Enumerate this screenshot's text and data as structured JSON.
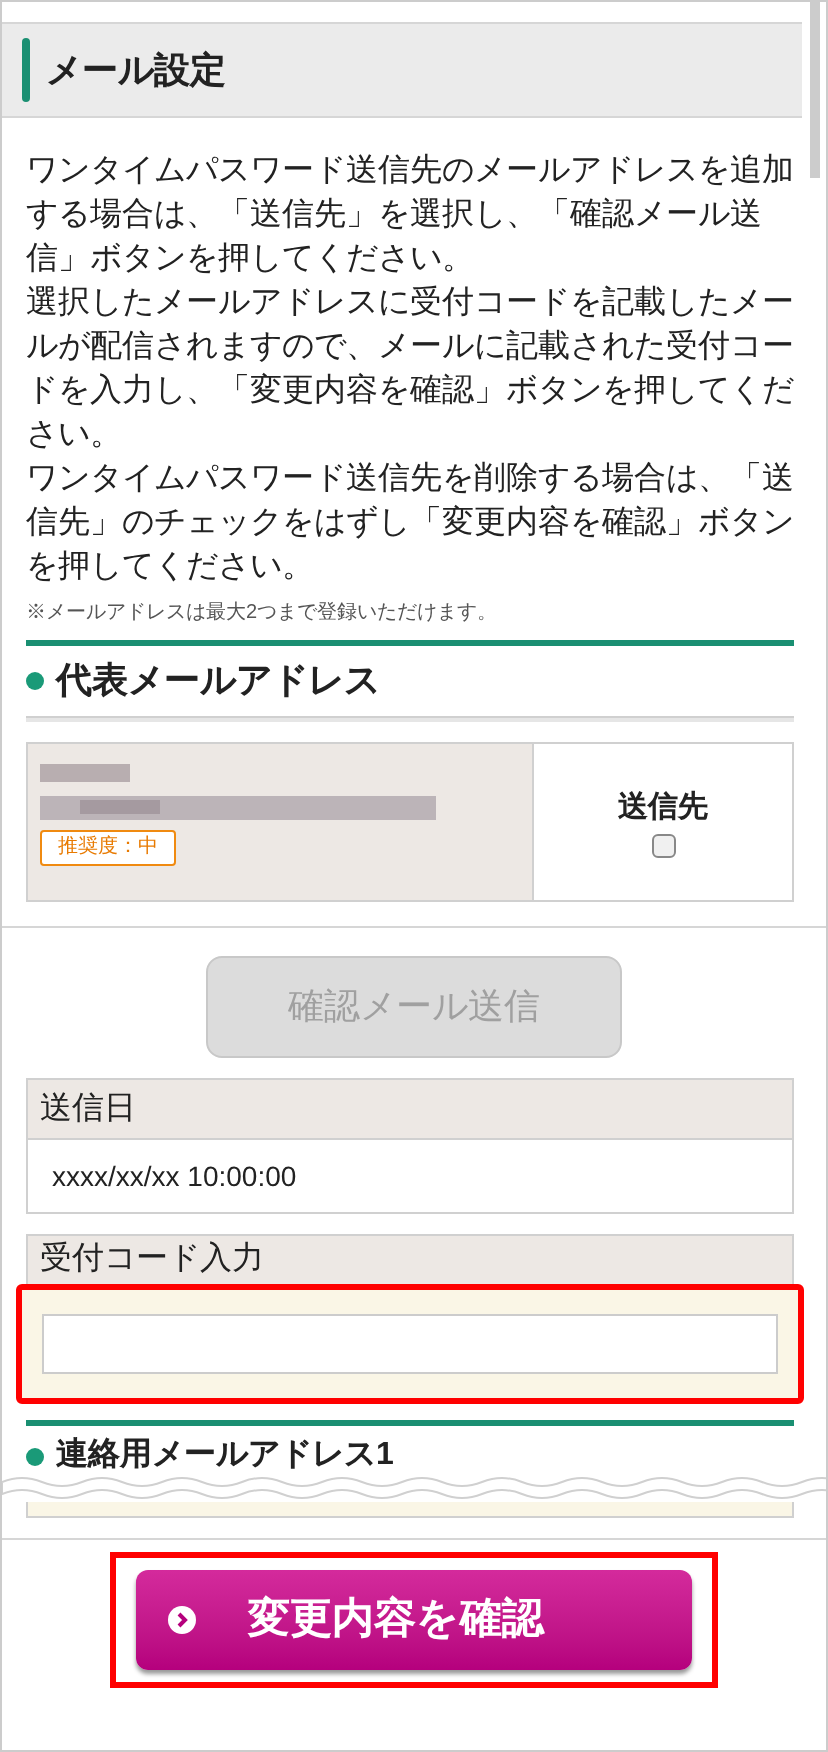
{
  "section_title": "メール設定",
  "intro": [
    "ワンタイムパスワード送信先のメールアドレスを追加する場合は、「送信先」を選択し、「確認メール送信」ボタンを押してください。",
    "選択したメールアドレスに受付コードを記載したメールが配信されますので、メールに記載された受付コードを入力し、「変更内容を確認」ボタンを押してください。",
    "ワンタイムパスワード送信先を削除する場合は、「送信先」のチェックをはずし「変更内容を確認」ボタンを押してください。"
  ],
  "note": "※メールアドレスは最大2つまで登録いただけます。",
  "primary_email": {
    "heading": "代表メールアドレス",
    "badge": "推奨度：中",
    "recipient_label": "送信先",
    "checked": false
  },
  "send_button": {
    "label": "確認メール送信",
    "disabled": true
  },
  "sent_date": {
    "label": "送信日",
    "value": "xxxx/xx/xx 10:00:00"
  },
  "code_input": {
    "label": "受付コード入力",
    "highlighted": true
  },
  "next_heading": "連絡用メールアドレス1",
  "confirm_button": {
    "label": "変更内容を確認",
    "highlighted": true
  }
}
